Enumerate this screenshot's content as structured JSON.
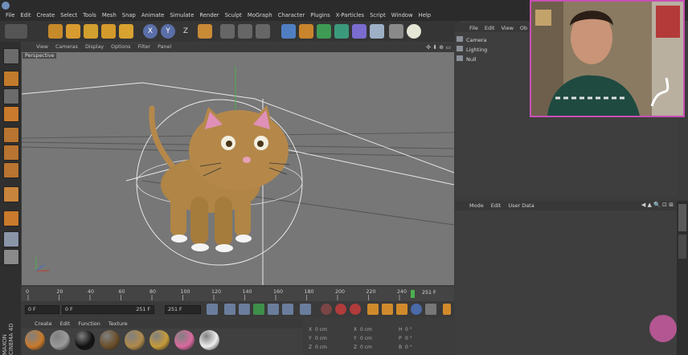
{
  "menu": [
    "File",
    "Edit",
    "Create",
    "Select",
    "Tools",
    "Mesh",
    "Snap",
    "Animate",
    "Simulate",
    "Render",
    "Sculpt",
    "MoGraph",
    "Character",
    "Plugins",
    "X-Particles",
    "Script",
    "Window",
    "Help"
  ],
  "toolbar": {
    "axis_x": "X",
    "axis_y": "Y",
    "axis_z": "Z"
  },
  "viewport": {
    "menu": [
      "View",
      "Cameras",
      "Display",
      "Options",
      "Filter",
      "Panel"
    ],
    "label": "Perspective"
  },
  "timeline": {
    "ticks": [
      "0",
      "20",
      "40",
      "60",
      "80",
      "100",
      "120",
      "140",
      "160",
      "180",
      "200",
      "220",
      "240"
    ],
    "end_frame": "251 F",
    "current_frame": "0 F",
    "start_field": "0 F",
    "preview_start": "0 F",
    "preview_end": "251 F",
    "end_field": "251 F"
  },
  "materials": {
    "menu": [
      "Create",
      "Edit",
      "Function",
      "Texture"
    ],
    "swatches": [
      {
        "icon": "material-swatch",
        "color": "#c77a2c"
      },
      {
        "icon": "material-swatch",
        "color": "#9a9a9a"
      },
      {
        "icon": "material-swatch",
        "color": "#111111"
      },
      {
        "icon": "material-swatch",
        "color": "#6b4f2a"
      },
      {
        "icon": "material-swatch",
        "color": "#b08a4a"
      },
      {
        "icon": "material-swatch",
        "color": "#c59a3a"
      },
      {
        "icon": "material-swatch",
        "color": "#d86a9e"
      },
      {
        "icon": "material-swatch",
        "color": "#eeeeee"
      }
    ]
  },
  "coordinates": {
    "rows": [
      {
        "a": "X",
        "av": "0 cm",
        "b": "X",
        "bv": "0 cm",
        "c": "H",
        "cv": "0 °"
      },
      {
        "a": "Y",
        "av": "0 cm",
        "b": "Y",
        "bv": "0 cm",
        "c": "P",
        "cv": "0 °"
      },
      {
        "a": "Z",
        "av": "0 cm",
        "b": "Z",
        "bv": "0 cm",
        "c": "B",
        "cv": "0 °"
      }
    ]
  },
  "object_manager": {
    "menu": [
      "File",
      "Edit",
      "View",
      "Ob"
    ],
    "objects": [
      {
        "name": "Camera",
        "icon": "camera-icon"
      },
      {
        "name": "Lighting",
        "icon": "null-icon"
      },
      {
        "name": "Null",
        "icon": "null-icon"
      }
    ]
  },
  "attribute_manager": {
    "menu": [
      "Mode",
      "Edit",
      "User Data"
    ]
  },
  "side_label": "MAXON CINEMA 4D",
  "colors": {
    "accent_pink": "#c84fb5",
    "viewport_bg": "#777777"
  }
}
